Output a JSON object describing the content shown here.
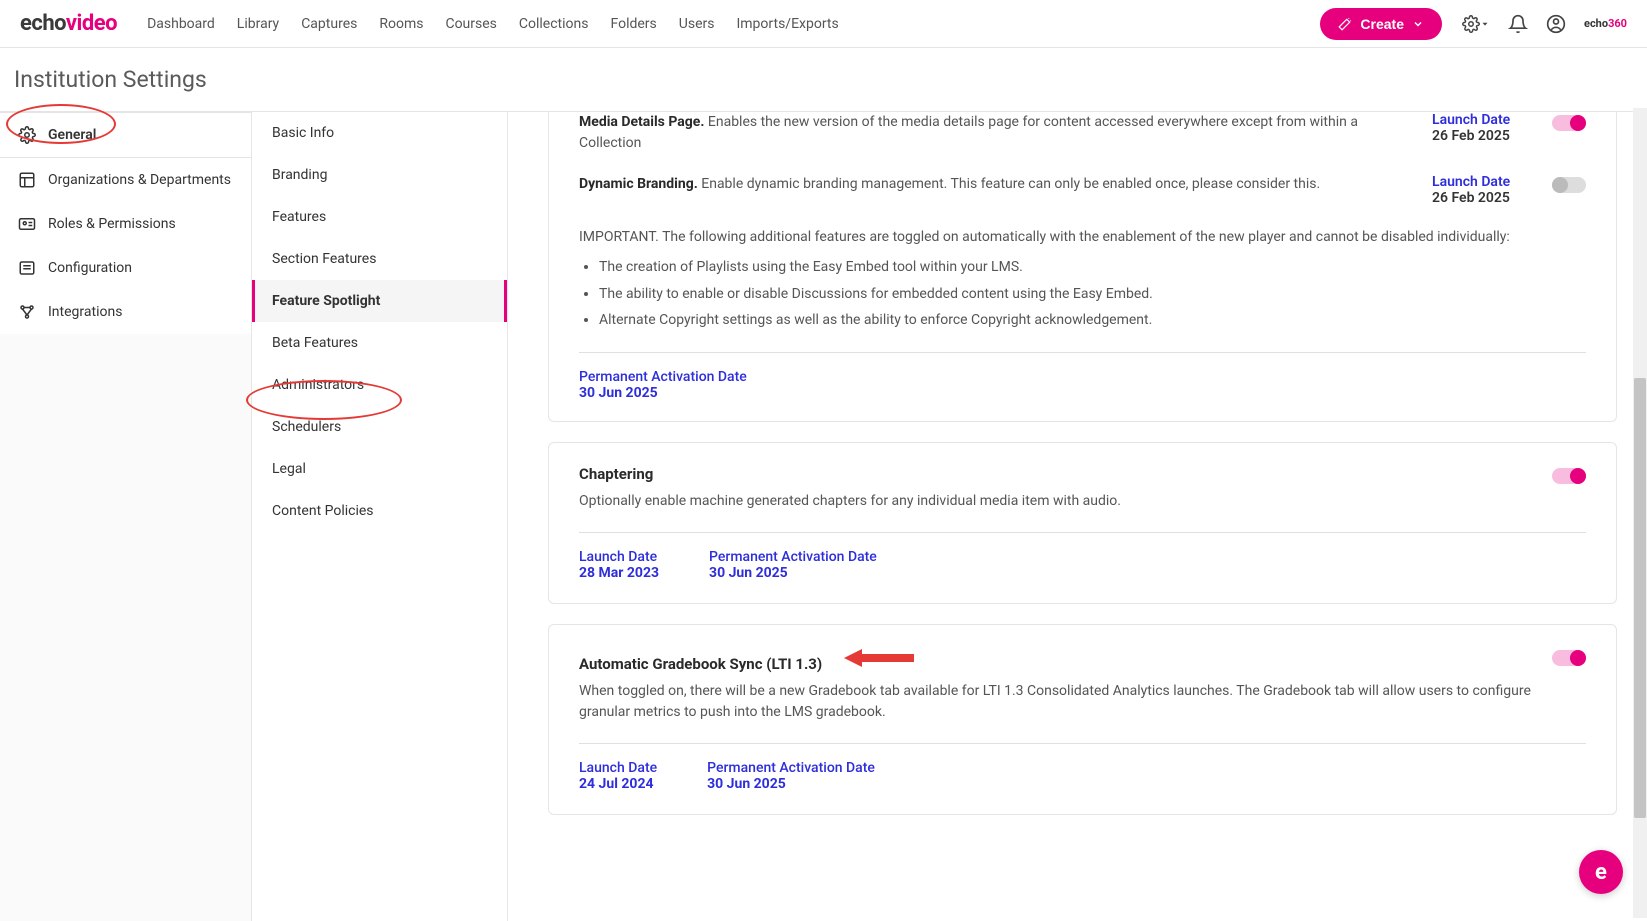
{
  "logo": {
    "part1": "echo",
    "part2": "video"
  },
  "nav": [
    "Dashboard",
    "Library",
    "Captures",
    "Rooms",
    "Courses",
    "Collections",
    "Folders",
    "Users",
    "Imports/Exports"
  ],
  "createBtn": "Create",
  "topRightBrand": {
    "part1": "echo",
    "part2": "360"
  },
  "pageTitle": "Institution Settings",
  "sidebar1": [
    {
      "label": "General",
      "icon": "gear",
      "active": true
    },
    {
      "label": "Organizations & Departments",
      "icon": "org"
    },
    {
      "label": "Roles & Permissions",
      "icon": "id"
    },
    {
      "label": "Configuration",
      "icon": "config"
    },
    {
      "label": "Integrations",
      "icon": "integrations"
    }
  ],
  "sidebar2": [
    {
      "label": "Basic Info"
    },
    {
      "label": "Branding"
    },
    {
      "label": "Features"
    },
    {
      "label": "Section Features"
    },
    {
      "label": "Feature Spotlight",
      "active": true
    },
    {
      "label": "Beta Features"
    },
    {
      "label": "Administrators"
    },
    {
      "label": "Schedulers"
    },
    {
      "label": "Legal"
    },
    {
      "label": "Content Policies"
    }
  ],
  "features": {
    "mediaDetails": {
      "title": "Media Details Page.",
      "desc": "Enables the new version of the media details page for content accessed everywhere except from within a Collection",
      "launchLabel": "Launch Date",
      "launchDate": "26 Feb 2025",
      "on": true
    },
    "dynamicBranding": {
      "title": "Dynamic Branding.",
      "desc": "Enable dynamic branding management. This feature can only be enabled once, please consider this.",
      "launchLabel": "Launch Date",
      "launchDate": "26 Feb 2025",
      "on": false
    },
    "important": {
      "lead": "IMPORTANT. The following additional features are toggled on automatically with the enablement of the new player and cannot be disabled individually:",
      "bullets": [
        "The creation of Playlists using the Easy Embed tool within your LMS.",
        "The ability to enable or disable Discussions for embedded content using the Easy Embed.",
        "Alternate Copyright settings as well as the ability to enforce Copyright acknowledgement."
      ],
      "permLabel": "Permanent Activation Date",
      "permDate": "30 Jun 2025"
    },
    "chaptering": {
      "title": "Chaptering",
      "desc": "Optionally enable machine generated chapters for any individual media item with audio.",
      "launchLabel": "Launch Date",
      "launchDate": "28 Mar 2023",
      "permLabel": "Permanent Activation Date",
      "permDate": "30 Jun 2025",
      "on": true
    },
    "gradebook": {
      "title": "Automatic Gradebook Sync (LTI 1.3)",
      "desc": "When toggled on, there will be a new Gradebook tab available for LTI 1.3 Consolidated Analytics launches. The Gradebook tab will allow users to configure granular metrics to push into the LMS gradebook.",
      "launchLabel": "Launch Date",
      "launchDate": "24 Jul 2024",
      "permLabel": "Permanent Activation Date",
      "permDate": "30 Jun 2025",
      "on": true
    }
  }
}
